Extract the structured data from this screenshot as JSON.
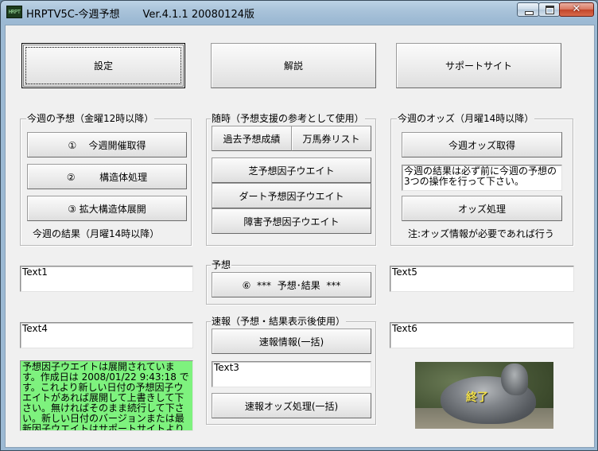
{
  "window": {
    "title": "HRPTV5C-今週予想       Ver.4.1.1 20080124版",
    "icon_text": "HRPT",
    "close_glyph": "✕"
  },
  "top_buttons": {
    "settings": "設定",
    "explanation": "解説",
    "support_site": "サポートサイト"
  },
  "group_weekly": {
    "title": "今週の予想（金曜12時以降）",
    "btn1": "①    今週開催取得",
    "btn2": "②        構造体処理",
    "btn3": "③ 拡大構造体展開",
    "note": "今週の結果（月曜14時以降）"
  },
  "group_anytime": {
    "title": "随時（予想支援の参考として使用）",
    "past_results": "過去予想成績",
    "big_payout_list": "万馬券リスト",
    "turf_weights": "芝予想因子ウエイト",
    "dirt_weights": "ダート予想因子ウエイト",
    "hurdle_weights": "障害予想因子ウエイト"
  },
  "group_odds": {
    "title": "今週のオッズ（月曜14時以降）",
    "get_odds": "今週オッズ取得",
    "warning_text": "今週の結果は必ず前に今週の予想の3つの操作を行って下さい。",
    "odds_process": "オッズ処理",
    "note": "注:オッズ情報が必要であれば行う"
  },
  "group_prediction": {
    "title": "予想",
    "button": "⑥  ***  予想･結果  ***"
  },
  "group_flash": {
    "title": "速報（予想・結果表示後使用）",
    "flash_info": "速報情報(一括)",
    "text3": "Text3",
    "flash_odds": "速報オッズ処理(一括)"
  },
  "textboxes": {
    "text1": "Text1",
    "text4": "Text4",
    "text5": "Text5",
    "text6": "Text6"
  },
  "status_message": "予想因子ウエイトは展開されています。作成日は 2008/01/22 9:43:18 です。これより新しい日付の予想因子ウエイトがあれば展開して上書きして下さい。無ければそのまま続行して下さい。新しい日付のバージョンまたは最新因子ウエイトはサポートサイトよりダウンロードして下さい。",
  "exit_image": {
    "label": "終了"
  }
}
